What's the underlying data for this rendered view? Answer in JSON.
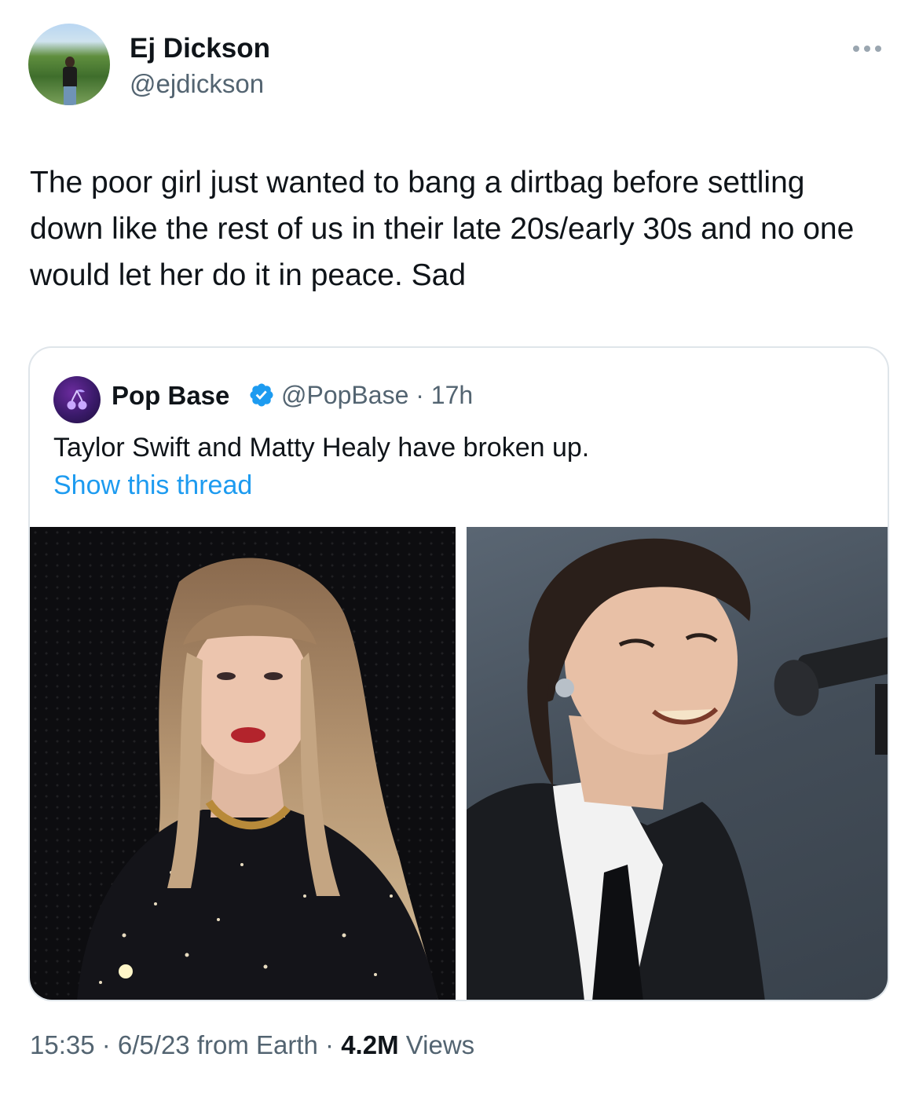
{
  "author": {
    "display_name": "Ej Dickson",
    "handle": "@ejdickson"
  },
  "tweet": {
    "text": "The poor girl just wanted to bang a dirtbag before settling down like the rest of us in their late 20s/early 30s and no one would let her do it in peace. Sad"
  },
  "quoted_tweet": {
    "display_name": "Pop Base",
    "handle_time": "@PopBase · 17h",
    "text": "Taylor Swift and Matty Healy have broken up.",
    "link": "Show this thread",
    "verified_icon": "verified-badge-icon"
  },
  "footer": {
    "time_date": "15:35 · 6/5/23 from Earth · ",
    "views_count": "4.2M",
    "views_label": " Views"
  },
  "colors": {
    "link": "#1d9bf0",
    "secondary_text": "#536471",
    "border": "#dfe5ea"
  }
}
